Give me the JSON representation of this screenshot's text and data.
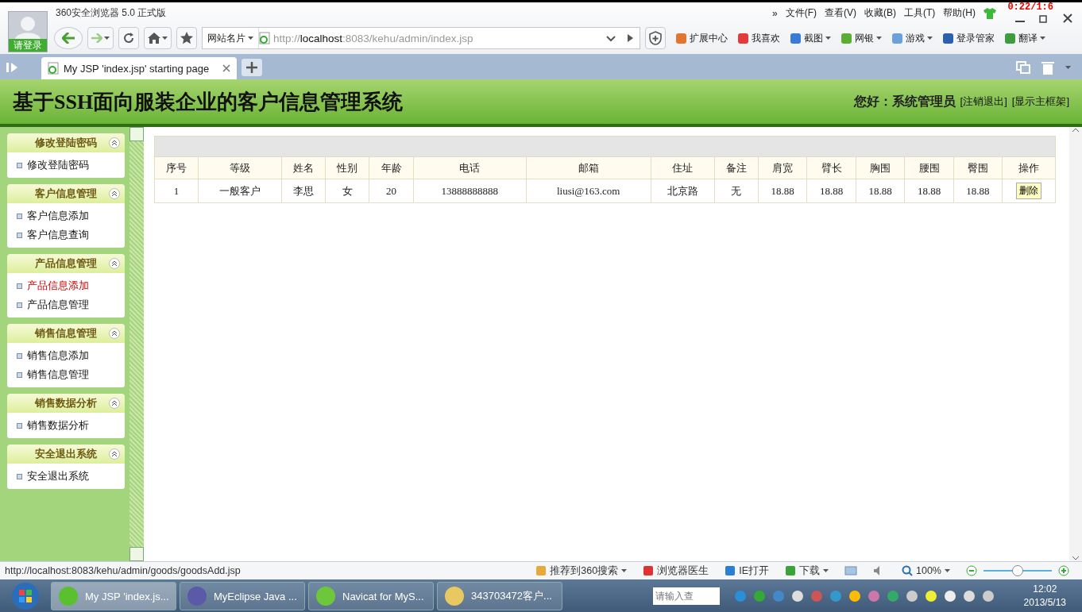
{
  "browser": {
    "title": "360安全浏览器 5.0 正式版",
    "login_label": "请登录",
    "recorder_timer": "0:22/1:6",
    "menu_more": "»",
    "menu": [
      "文件(F)",
      "查看(V)",
      "收藏(B)",
      "工具(T)",
      "帮助(H)"
    ],
    "site_card": "网站名片",
    "address": {
      "scheme": "http://",
      "host": "localhost",
      "rest": ":8083/kehu/admin/index.jsp"
    },
    "toolbar_items": [
      {
        "label": "扩展中心",
        "dropdown": false
      },
      {
        "label": "我喜欢",
        "dropdown": false
      },
      {
        "label": "截图",
        "dropdown": true
      },
      {
        "label": "网银",
        "dropdown": true
      },
      {
        "label": "游戏",
        "dropdown": true
      },
      {
        "label": "登录管家",
        "dropdown": false
      },
      {
        "label": "翻译",
        "dropdown": true
      }
    ],
    "tab": {
      "title": "My JSP 'index.jsp' starting page"
    }
  },
  "page": {
    "title": "基于SSH面向服装企业的客户信息管理系统",
    "greeting": "您好：系统管理员",
    "links": [
      "[注销退出]",
      "[显示主框架]"
    ]
  },
  "sidebar": {
    "groups": [
      {
        "title": "修改登陆密码",
        "expanded": true,
        "items": [
          {
            "label": "修改登陆密码",
            "selected": false
          }
        ]
      },
      {
        "title": "客户信息管理",
        "expanded": true,
        "items": [
          {
            "label": "客户信息添加",
            "selected": false
          },
          {
            "label": "客户信息查询",
            "selected": false
          }
        ]
      },
      {
        "title": "产品信息管理",
        "expanded": true,
        "items": [
          {
            "label": "产品信息添加",
            "selected": true
          },
          {
            "label": "产品信息管理",
            "selected": false
          }
        ]
      },
      {
        "title": "销售信息管理",
        "expanded": true,
        "items": [
          {
            "label": "销售信息添加",
            "selected": false
          },
          {
            "label": "销售信息管理",
            "selected": false
          }
        ]
      },
      {
        "title": "销售数据分析",
        "expanded": true,
        "items": [
          {
            "label": "销售数据分析",
            "selected": false
          }
        ]
      },
      {
        "title": "安全退出系统",
        "expanded": true,
        "items": [
          {
            "label": "安全退出系统",
            "selected": false
          }
        ]
      }
    ]
  },
  "table": {
    "columns": [
      "序号",
      "等级",
      "姓名",
      "性别",
      "年龄",
      "电话",
      "邮箱",
      "住址",
      "备注",
      "肩宽",
      "臂长",
      "胸围",
      "腰围",
      "臀围",
      "操作"
    ],
    "rows": [
      {
        "cells": [
          "1",
          "一般客户",
          "李思",
          "女",
          "20",
          "13888888888",
          "liusi@163.com",
          "北京路",
          "无",
          "18.88",
          "18.88",
          "18.88",
          "18.88",
          "18.88"
        ],
        "action": "删除"
      }
    ]
  },
  "status_bar": {
    "url": "http://localhost:8083/kehu/admin/goods/goodsAdd.jsp",
    "items": [
      {
        "label": "推荐到360搜索",
        "dropdown": true
      },
      {
        "label": "浏览器医生",
        "dropdown": false
      },
      {
        "label": "IE打开",
        "dropdown": false
      },
      {
        "label": "下载",
        "dropdown": true
      }
    ],
    "zoom": "100%",
    "zoom_slider": {
      "level": 0.5
    }
  },
  "taskbar": {
    "buttons": [
      {
        "label": "My JSP 'index.js...",
        "selected": true
      },
      {
        "label": "MyEclipse Java ...",
        "selected": false
      },
      {
        "label": "Navicat for MyS...",
        "selected": false
      },
      {
        "label": "343703472客户...",
        "selected": false
      }
    ],
    "search_placeholder": "请输入查",
    "time": "12:02",
    "date": "2013/5/13"
  }
}
